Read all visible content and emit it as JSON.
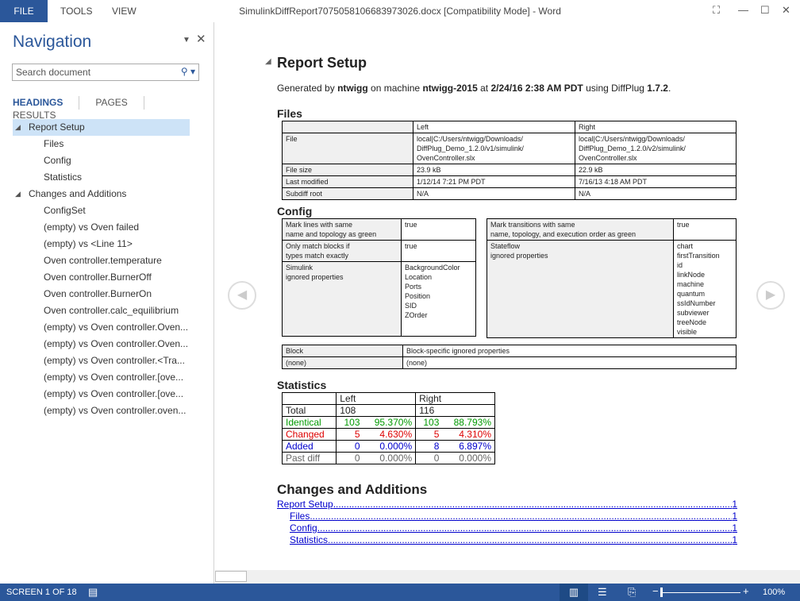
{
  "ribbon": {
    "tabs": [
      "FILE",
      "TOOLS",
      "VIEW"
    ],
    "title": "SimulinkDiffReport7075058106683973026.docx [Compatibility Mode] - Word"
  },
  "nav": {
    "title": "Navigation",
    "search_placeholder": "Search document",
    "tabs": [
      "HEADINGS",
      "PAGES",
      "RESULTS"
    ],
    "items": [
      {
        "label": "Report Setup",
        "level": 0,
        "selected": true
      },
      {
        "label": "Files",
        "level": 1
      },
      {
        "label": "Config",
        "level": 1
      },
      {
        "label": "Statistics",
        "level": 1
      },
      {
        "label": "Changes and Additions",
        "level": 0
      },
      {
        "label": "ConfigSet",
        "level": 1
      },
      {
        "label": "(empty) vs Oven failed",
        "level": 1
      },
      {
        "label": "(empty) vs <Line 11>",
        "level": 1
      },
      {
        "label": "Oven controller.temperature",
        "level": 1
      },
      {
        "label": "Oven controller.BurnerOff",
        "level": 1
      },
      {
        "label": "Oven controller.BurnerOn",
        "level": 1
      },
      {
        "label": "Oven controller.calc_equilibrium",
        "level": 1
      },
      {
        "label": "(empty) vs Oven controller.Oven...",
        "level": 1
      },
      {
        "label": "(empty) vs Oven controller.Oven...",
        "level": 1
      },
      {
        "label": "(empty) vs Oven controller.<Tra...",
        "level": 1
      },
      {
        "label": "(empty) vs Oven controller.[ove...",
        "level": 1
      },
      {
        "label": "(empty) vs Oven controller.[ove...",
        "level": 1
      },
      {
        "label": "(empty) vs Oven controller.oven...",
        "level": 1
      }
    ]
  },
  "doc": {
    "title": "Report Setup",
    "gen": {
      "a": "Generated by ",
      "user": "ntwigg",
      "b": " on machine ",
      "machine": "ntwigg-2015",
      "c": " at ",
      "date": "2/24/16 2:38 AM PDT",
      "d": " using DiffPlug ",
      "ver": "1.7.2",
      "e": "."
    },
    "files_h": "Files",
    "files": {
      "head": [
        "",
        "Left",
        "Right"
      ],
      "rows": [
        [
          "File",
          "local|C:/Users/ntwigg/Downloads/\nDiffPlug_Demo_1.2.0/v1/simulink/\nOvenController.slx",
          "local|C:/Users/ntwigg/Downloads/\nDiffPlug_Demo_1.2.0/v2/simulink/\nOvenController.slx"
        ],
        [
          "File size",
          "23.9 kB",
          "22.9 kB"
        ],
        [
          "Last modified",
          "1/12/14 7:21 PM PDT",
          "7/16/13 4:18 AM PDT"
        ],
        [
          "Subdiff root",
          "N/A",
          "N/A"
        ]
      ]
    },
    "config_h": "Config",
    "config_left": [
      [
        "Mark lines with same\nname and topology as green",
        "true"
      ],
      [
        "Only match blocks if\ntypes match exactly",
        "true"
      ],
      [
        "Simulink\nignored properties",
        "BackgroundColor\nLocation\nPorts\nPosition\nSID\nZOrder"
      ]
    ],
    "config_right": [
      [
        "Mark transitions with same\nname, topology, and execution order as green",
        "true"
      ],
      [
        "Stateflow\nignored properties",
        "chart\nfirstTransition\nid\nlinkNode\nmachine\nquantum\nssIdNumber\nsubviewer\ntreeNode\nvisible"
      ]
    ],
    "block": [
      [
        "Block",
        "Block-specific ignored properties"
      ],
      [
        "(none)",
        "(none)"
      ]
    ],
    "stats_h": "Statistics",
    "stats": {
      "head": [
        "",
        "Left",
        "Right"
      ],
      "rows": [
        [
          "Total",
          "108",
          "",
          "116",
          ""
        ],
        [
          "Identical",
          "103",
          "95.370%",
          "103",
          "88.793%"
        ],
        [
          "Changed",
          "5",
          "4.630%",
          "5",
          "4.310%"
        ],
        [
          "Added",
          "0",
          "0.000%",
          "8",
          "6.897%"
        ],
        [
          "Past diff",
          "0",
          "0.000%",
          "0",
          "0.000%"
        ]
      ]
    },
    "changes_h": "Changes and Additions",
    "toc": [
      {
        "label": "Report Setup",
        "page": "1"
      },
      {
        "label": "Files",
        "page": "1"
      },
      {
        "label": "Config",
        "page": "1"
      },
      {
        "label": "Statistics",
        "page": "1"
      }
    ]
  },
  "status": {
    "screen": "SCREEN 1 OF 18",
    "zoom": "100%"
  },
  "colors": {
    "accent": "#2b579a",
    "identical": "#009900",
    "changed": "#dd0000",
    "added": "#0000cc",
    "past": "#666666"
  }
}
